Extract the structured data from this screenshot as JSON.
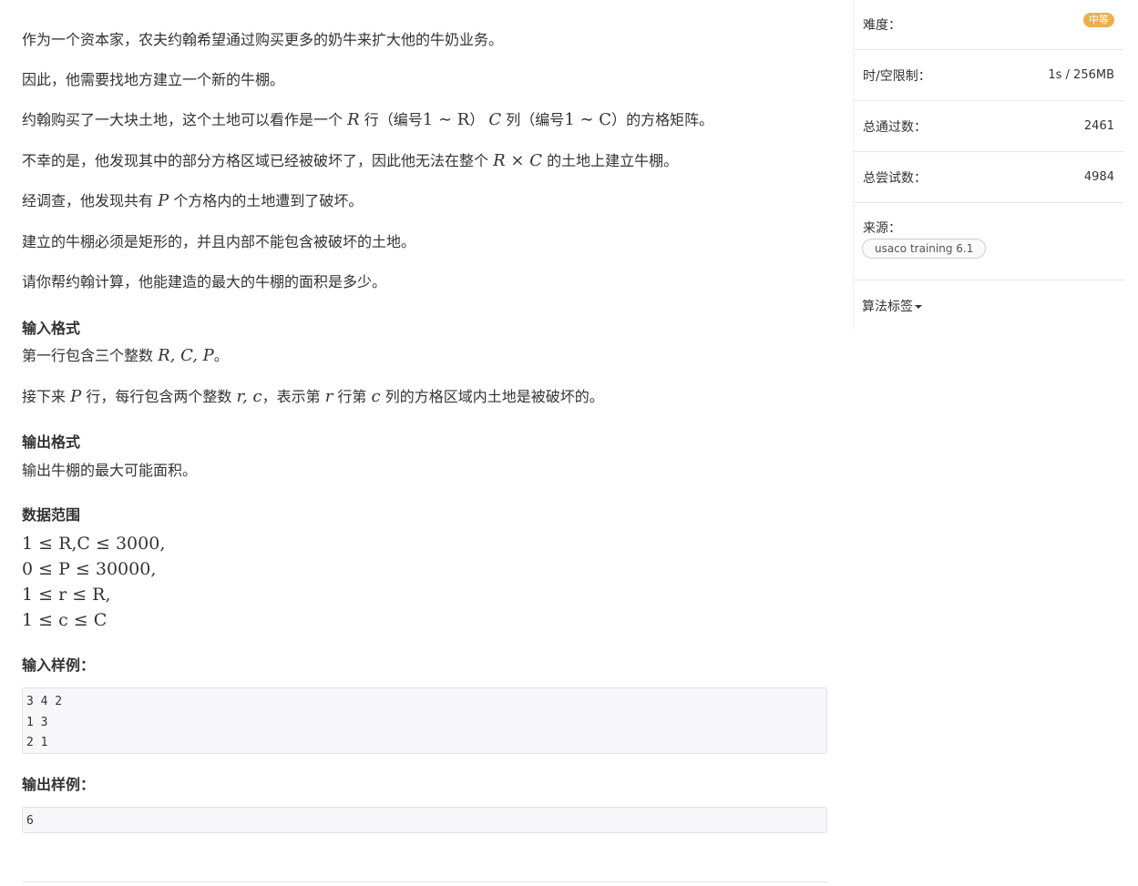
{
  "statement": {
    "p1": "作为一个资本家，农夫约翰希望通过购买更多的奶牛来扩大他的牛奶业务。",
    "p2": "因此，他需要找地方建立一个新的牛棚。",
    "p3_a": "约翰购买了一大块土地，这个土地可以看作是一个",
    "p3_R1": "R",
    "p3_b": "行（编号",
    "p3_range1": "1 ∼ R",
    "p3_c": "）",
    "p3_C1": "C",
    "p3_d": "列（编号",
    "p3_range2": "1 ∼ C",
    "p3_e": "）的方格矩阵。",
    "p4_a": "不幸的是，他发现其中的部分方格区域已经被破坏了，因此他无法在整个",
    "p4_RxC": "R × C",
    "p4_b": "的土地上建立牛棚。",
    "p5_a": "经调查，他发现共有",
    "p5_P": "P",
    "p5_b": "个方格内的土地遭到了破坏。",
    "p6": "建立的牛棚必须是矩形的，并且内部不能包含被破坏的土地。",
    "p7": "请你帮约翰计算，他能建造的最大的牛棚的面积是多少。"
  },
  "input_format": {
    "heading": "输入格式",
    "l1_a": "第一行包含三个整数",
    "l1_vars": "R, C, P",
    "l1_b": "。",
    "l2_a": "接下来",
    "l2_P": "P",
    "l2_b": "行，每行包含两个整数",
    "l2_rc": "r, c",
    "l2_c": "，表示第",
    "l2_r": "r",
    "l2_d": "行第",
    "l2_col": "c",
    "l2_e": "列的方格区域内土地是被破坏的。"
  },
  "output_format": {
    "heading": "输出格式",
    "text": "输出牛棚的最大可能面积。"
  },
  "constraints": {
    "heading": "数据范围",
    "lines": [
      "1 ≤ R,C ≤ 3000,",
      "0 ≤ P ≤ 30000,",
      "1 ≤ r ≤ R,",
      "1 ≤ c ≤ C"
    ]
  },
  "sample_input": {
    "heading": "输入样例：",
    "content": "3 4 2\n1 3\n2 1"
  },
  "sample_output": {
    "heading": "输出样例：",
    "content": "6"
  },
  "sidebar": {
    "difficulty_label": "难度：",
    "difficulty_value": "中等",
    "difficulty_color": "#f0ad4e",
    "limit_label": "时/空限制：",
    "limit_value": "1s / 256MB",
    "passed_label": "总通过数：",
    "passed_value": "2461",
    "attempts_label": "总尝试数：",
    "attempts_value": "4984",
    "source_label": "来源：",
    "source_tag": "usaco training 6.1",
    "tags_label": "算法标签"
  }
}
